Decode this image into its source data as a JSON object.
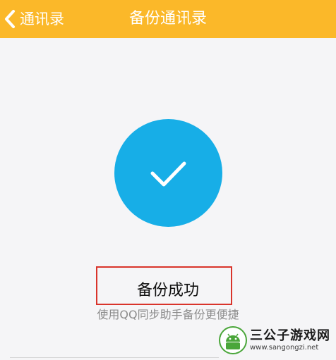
{
  "header": {
    "back_label": "通讯录",
    "title": "备份通讯录"
  },
  "main": {
    "success_text": "备份成功",
    "hint_text": "使用QQ同步助手备份更便捷"
  },
  "watermark": {
    "title": "三公子游戏网",
    "url": "www.sangongzi.net"
  },
  "icons": {
    "back": "chevron-left-icon",
    "success": "checkmark-icon",
    "watermark_logo": "android-robot-icon"
  },
  "colors": {
    "header": "#fbb829",
    "circle": "#17aee7",
    "highlight_border": "#d9342b",
    "background": "#f5f5f7"
  }
}
